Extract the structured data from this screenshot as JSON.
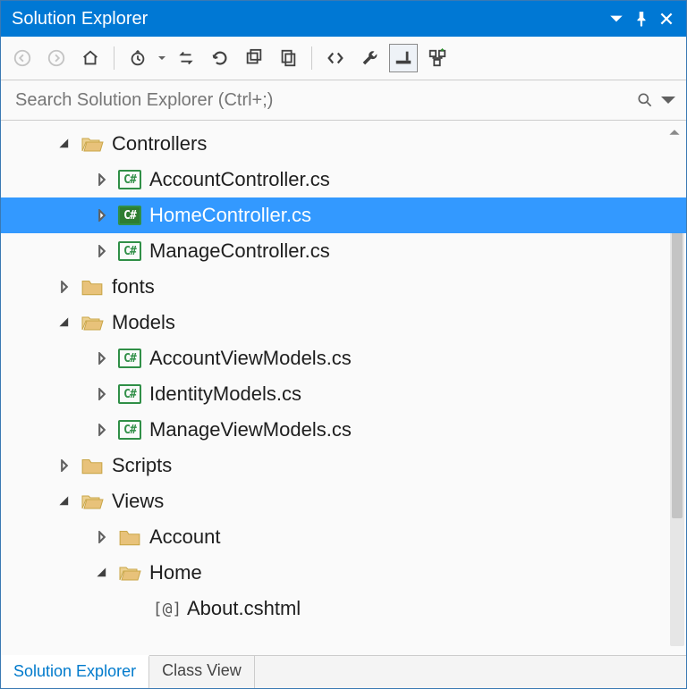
{
  "title": "Solution Explorer",
  "search": {
    "placeholder": "Search Solution Explorer (Ctrl+;)"
  },
  "tabs": {
    "active": "Solution Explorer",
    "inactive": "Class View"
  },
  "tree": [
    {
      "depth": 0,
      "expander": "expanded",
      "icon": "folder-open",
      "label": "Controllers",
      "selected": false
    },
    {
      "depth": 1,
      "expander": "collapsed",
      "icon": "cs",
      "label": "AccountController.cs",
      "selected": false
    },
    {
      "depth": 1,
      "expander": "collapsed",
      "icon": "cs",
      "label": "HomeController.cs",
      "selected": true
    },
    {
      "depth": 1,
      "expander": "collapsed",
      "icon": "cs",
      "label": "ManageController.cs",
      "selected": false
    },
    {
      "depth": 0,
      "expander": "collapsed",
      "icon": "folder",
      "label": "fonts",
      "selected": false
    },
    {
      "depth": 0,
      "expander": "expanded",
      "icon": "folder-open",
      "label": "Models",
      "selected": false
    },
    {
      "depth": 1,
      "expander": "collapsed",
      "icon": "cs",
      "label": "AccountViewModels.cs",
      "selected": false
    },
    {
      "depth": 1,
      "expander": "collapsed",
      "icon": "cs",
      "label": "IdentityModels.cs",
      "selected": false
    },
    {
      "depth": 1,
      "expander": "collapsed",
      "icon": "cs",
      "label": "ManageViewModels.cs",
      "selected": false
    },
    {
      "depth": 0,
      "expander": "collapsed",
      "icon": "folder",
      "label": "Scripts",
      "selected": false
    },
    {
      "depth": 0,
      "expander": "expanded",
      "icon": "folder-open",
      "label": "Views",
      "selected": false
    },
    {
      "depth": 1,
      "expander": "collapsed",
      "icon": "folder",
      "label": "Account",
      "selected": false
    },
    {
      "depth": 1,
      "expander": "expanded",
      "icon": "folder-open",
      "label": "Home",
      "selected": false
    },
    {
      "depth": 2,
      "expander": "none",
      "icon": "razor",
      "label": "About.cshtml",
      "selected": false
    }
  ]
}
